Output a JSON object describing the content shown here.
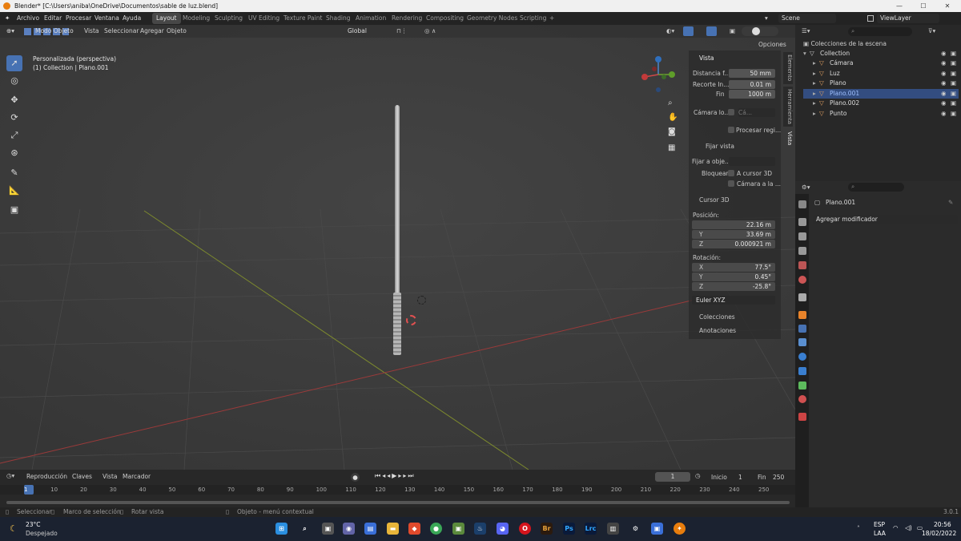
{
  "window": {
    "title": "Blender* [C:\\Users\\aniba\\OneDrive\\Documentos\\sable de luz.blend]",
    "minimize": "—",
    "maximize": "☐",
    "close": "✕"
  },
  "menu": [
    "Archivo",
    "Editar",
    "Procesar",
    "Ventana",
    "Ayuda"
  ],
  "workspaces": [
    "Layout",
    "Modeling",
    "Sculpting",
    "UV Editing",
    "Texture Paint",
    "Shading",
    "Animation",
    "Rendering",
    "Compositing",
    "Geometry Nodes",
    "Scripting"
  ],
  "scene": {
    "name": "Scene",
    "viewlayer": "ViewLayer"
  },
  "viewport": {
    "mode": "Modo Objeto",
    "menus": [
      "Vista",
      "Seleccionar",
      "Agregar",
      "Objeto"
    ],
    "orientation": "Global",
    "options": "Opciones",
    "info_line1": "Personalizada (perspectiva)",
    "info_line2": "(1) Collection | Plano.001"
  },
  "npanel": {
    "tabs": [
      "Elemento",
      "Herramienta",
      "Vista"
    ],
    "view": {
      "title": "Vista",
      "focal_label": "Distancia f...",
      "focal": "50 mm",
      "clip_label": "Recorte  In...",
      "clip_start": "0.01 m",
      "end_label": "Fin",
      "clip_end": "1000 m",
      "camera_label": "Cámara lo...",
      "camera_field": "Cá...",
      "render_region": "Procesar regi..."
    },
    "lock": {
      "title": "Fijar vista",
      "lock_obj_label": "Fijar a obje...",
      "lock_label": "Bloquear",
      "to_cursor": "A cursor 3D",
      "to_camera": "Cámara a la ..."
    },
    "cursor": {
      "title": "Cursor 3D",
      "pos_label": "Posición:",
      "x": "22.16 m",
      "y": "33.69 m",
      "z": "0.000921 m",
      "rot_label": "Rotación:",
      "rx": "77.5°",
      "ry": "0.45°",
      "rz": "-25.8°",
      "mode": "Euler XYZ",
      "X": "X",
      "Y": "Y",
      "Z": "Z"
    },
    "collections": "Colecciones",
    "annotations": "Anotaciones"
  },
  "outliner": {
    "root": "Colecciones de la escena",
    "items": [
      {
        "label": "Collection",
        "color": "#cccccc"
      },
      {
        "label": "Cámara",
        "color": "#e0a060"
      },
      {
        "label": "Luz",
        "color": "#e0a060"
      },
      {
        "label": "Plano",
        "color": "#e0a060"
      },
      {
        "label": "Plano.001",
        "color": "#e0a060",
        "selected": true
      },
      {
        "label": "Plano.002",
        "color": "#e0a060"
      },
      {
        "label": "Punto",
        "color": "#e0a060"
      }
    ]
  },
  "properties": {
    "object": "Plano.001",
    "add_modifier": "Agregar modificador"
  },
  "timeline": {
    "menus": [
      "Reproducción",
      "Claves",
      "Vista",
      "Marcador"
    ],
    "current_frame": "1",
    "start_label": "Inicio",
    "start": "1",
    "end_label": "Fin",
    "end": "250",
    "ticks": [
      "1",
      "10",
      "20",
      "30",
      "40",
      "50",
      "60",
      "70",
      "80",
      "90",
      "100",
      "110",
      "120",
      "130",
      "140",
      "150",
      "160",
      "170",
      "180",
      "190",
      "200",
      "210",
      "220",
      "230",
      "240",
      "250"
    ]
  },
  "status": {
    "select": "Seleccionar",
    "box": "Marco de selección",
    "rotate": "Rotar vista",
    "context": "Objeto - menú contextual",
    "version": "3.0.1"
  },
  "taskbar": {
    "temp": "23°C",
    "weather": "Despejado",
    "lang1": "ESP",
    "lang2": "LAA",
    "time": "20:56",
    "date": "18/02/2022"
  },
  "colors": {
    "accent": "#4772b3",
    "selected_row": "#334d80"
  }
}
